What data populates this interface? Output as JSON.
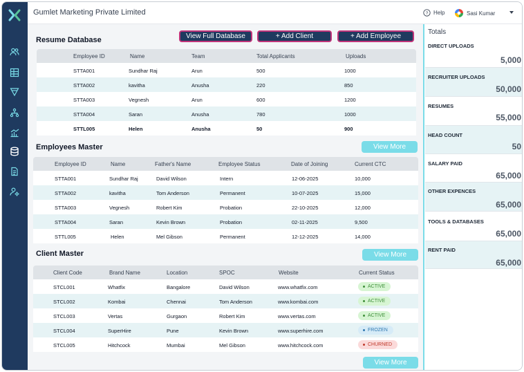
{
  "app": {
    "company_name": "Gumlet Marketing Private Limited",
    "help_label": "Help",
    "user_name": "Sasi Kumar"
  },
  "colors": {
    "sidebar": "#1f3a5f",
    "accent_cyan": "#7adce8",
    "button_border": "#c0347a",
    "active_green": "#d7f5d3",
    "frozen_blue": "#d6ebf7",
    "churned_red": "#fbdada"
  },
  "sidebar": {
    "icons": [
      "team-icon",
      "table-icon",
      "filter-icon",
      "hierarchy-icon",
      "analytics-icon",
      "database-icon",
      "document-icon",
      "user-settings-icon"
    ]
  },
  "resume_db": {
    "title": "Resume Database",
    "view_full_label": "View Full Database",
    "add_client_label": "+   Add Client",
    "add_employee_label": "+   Add Employee",
    "columns": [
      "Employee ID",
      "Name",
      "Team",
      "Total Applicants",
      "Uploads"
    ],
    "rows": [
      [
        "STTA001",
        "Sundhar Raj",
        "Arun",
        "500",
        "1000"
      ],
      [
        "STTA002",
        "kavitha",
        "Anusha",
        "220",
        "850"
      ],
      [
        "STTA003",
        "Vegnesh",
        "Arun",
        "600",
        "1200"
      ],
      [
        "STTA004",
        "Saran",
        "Anusha",
        "780",
        "1000"
      ],
      [
        "STTL005",
        "Helen",
        "Anusha",
        "50",
        "900"
      ]
    ]
  },
  "employees": {
    "title": "Employees Master",
    "view_more_label": "View More",
    "columns": [
      "Employee ID",
      "Name",
      "Father's Name",
      "Employee Status",
      "Date of Joining",
      "Current CTC"
    ],
    "rows": [
      [
        "STTA001",
        "Sundhar Raj",
        "David Wilson",
        "Intern",
        "12-06-2025",
        "10,000"
      ],
      [
        "STTA002",
        "kavitha",
        "Tom Anderson",
        "Permanent",
        "10-07-2025",
        "15,000"
      ],
      [
        "STTA003",
        "Vegnesh",
        "Robert Kim",
        "Probation",
        "22-10-2025",
        "12,000"
      ],
      [
        "STTA004",
        "Saran",
        "Kevin Brown",
        "Probation",
        "02-11-2025",
        "9,500"
      ],
      [
        "STTL005",
        "Helen",
        "Mel Gibson",
        "Permanent",
        "12-12-2025",
        "14,000"
      ]
    ]
  },
  "clients": {
    "title": "Client Master",
    "view_more_label": "View More",
    "columns": [
      "Client Code",
      "Brand Name",
      "Location",
      "SPOC",
      "Website",
      "Current Status"
    ],
    "rows": [
      [
        "STCL001",
        "Whatfix",
        "Bangalore",
        "David Wilson",
        "www.whatfix.com",
        "ACTIVE"
      ],
      [
        "STCL002",
        "Kombai",
        "Chennai",
        "Tom Anderson",
        "www.kombai.com",
        "ACTIVE"
      ],
      [
        "STCL003",
        "Vertas",
        "Gurgaon",
        "Robert Kim",
        "www.vertas.com",
        "ACTIVE"
      ],
      [
        "STCL004",
        "SuperHire",
        "Pune",
        "Kevin Brown",
        "www.superhire.com",
        "FROZEN"
      ],
      [
        "STCL005",
        "Hitchcock",
        "Mumbai",
        "Mel Gibson",
        "www.hitchcock.com",
        "CHURNED"
      ]
    ],
    "bottom_view_more_label": "View More"
  },
  "totals": {
    "title": "Totals",
    "items": [
      {
        "label": "DIRECT UPLOADS",
        "value": "5,000"
      },
      {
        "label": "RECRUITER UPLOADS",
        "value": "50,000"
      },
      {
        "label": "RESUMES",
        "value": "55,000"
      },
      {
        "label": "HEAD COUNT",
        "value": "50"
      },
      {
        "label": "SALARY PAID",
        "value": "65,000"
      },
      {
        "label": "OTHER EXPENCES",
        "value": "65,000"
      },
      {
        "label": "TOOLS & DATABASES",
        "value": "65,000"
      },
      {
        "label": "RENT PAID",
        "value": "65,000"
      }
    ]
  }
}
